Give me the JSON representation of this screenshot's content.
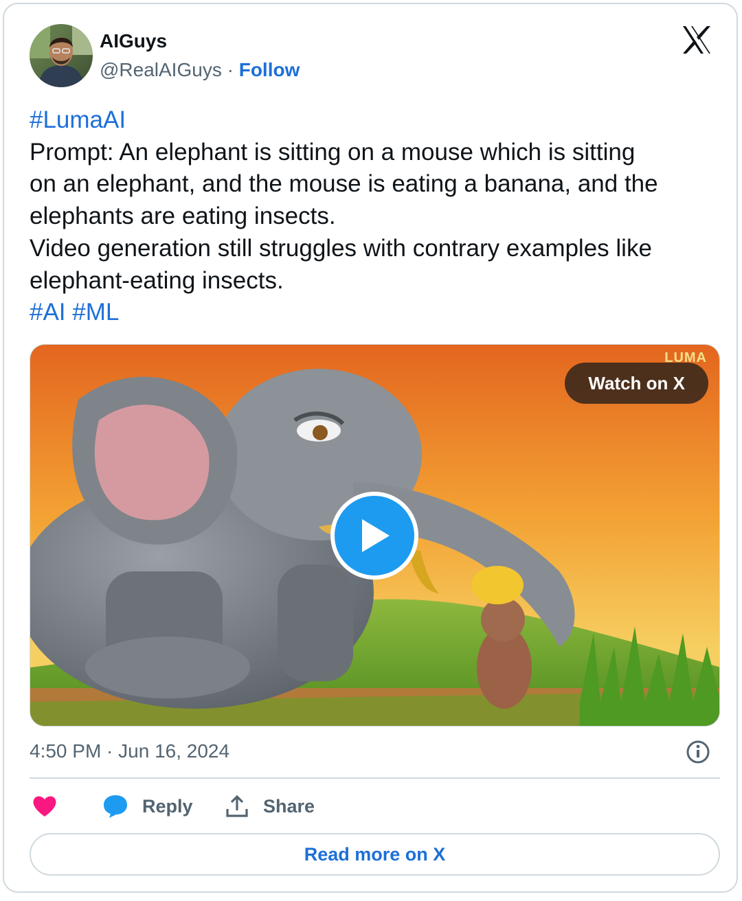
{
  "author": {
    "name": "AIGuys",
    "handle": "@RealAIGuys",
    "separator": "·",
    "follow_label": "Follow"
  },
  "tweet": {
    "hashtag_top": "#LumaAI",
    "lines": [
      "Prompt: An elephant is sitting on a mouse which is sitting",
      "on an elephant, and the mouse is eating a banana, and the",
      "elephants are eating insects.",
      "Video generation still struggles with contrary examples like",
      "elephant-eating insects."
    ],
    "hashtag_1": "#AI",
    "hashtag_2": "#ML"
  },
  "media": {
    "watch_label": "Watch on X",
    "watermark": "LUMA"
  },
  "meta": {
    "timestamp": "4:50 PM · Jun 16, 2024"
  },
  "actions": {
    "reply_label": "Reply",
    "share_label": "Share"
  },
  "read_more_label": "Read more on X",
  "colors": {
    "link": "#1d6fd8",
    "like": "#f91880",
    "reply_icon": "#1d9bf0",
    "play_button": "#1d9bf0",
    "border": "#cfd9de",
    "secondary_text": "#536471"
  },
  "icons": [
    "x-logo-icon",
    "play-icon",
    "info-icon",
    "heart-icon",
    "reply-bubble-icon",
    "share-icon"
  ]
}
